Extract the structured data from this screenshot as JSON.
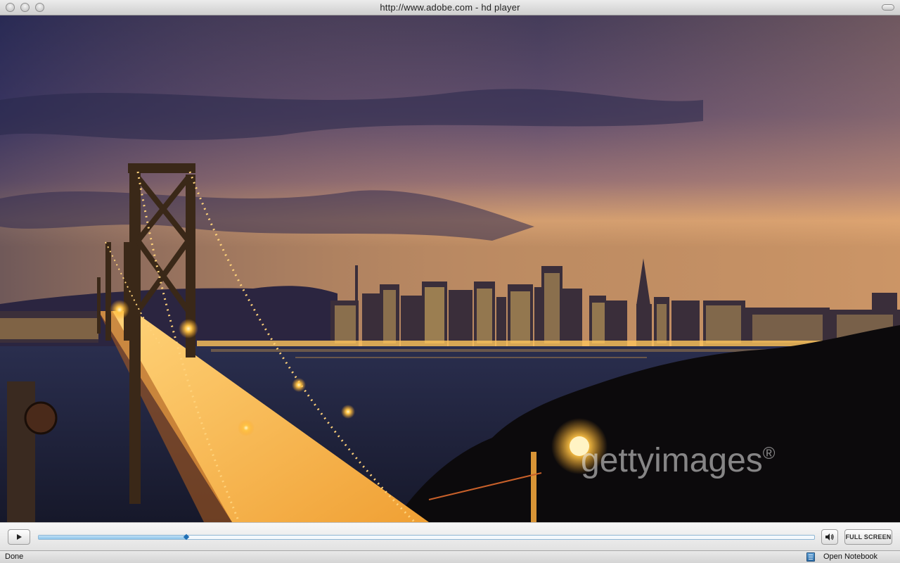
{
  "window": {
    "title": "http://www.adobe.com - hd player"
  },
  "video": {
    "watermark": "gettyimages",
    "watermark_mark": "®"
  },
  "controls": {
    "play_icon": "play-icon",
    "progress": 0.19,
    "volume_icon": "speaker-icon",
    "fullscreen_label": "FULL SCREEN"
  },
  "statusbar": {
    "status": "Done",
    "notebook_icon": "notebook-icon",
    "notebook_label": "Open Notebook"
  },
  "colors": {
    "seek_fill": "#8cc4ea",
    "seek_handle": "#1f6fb5"
  }
}
